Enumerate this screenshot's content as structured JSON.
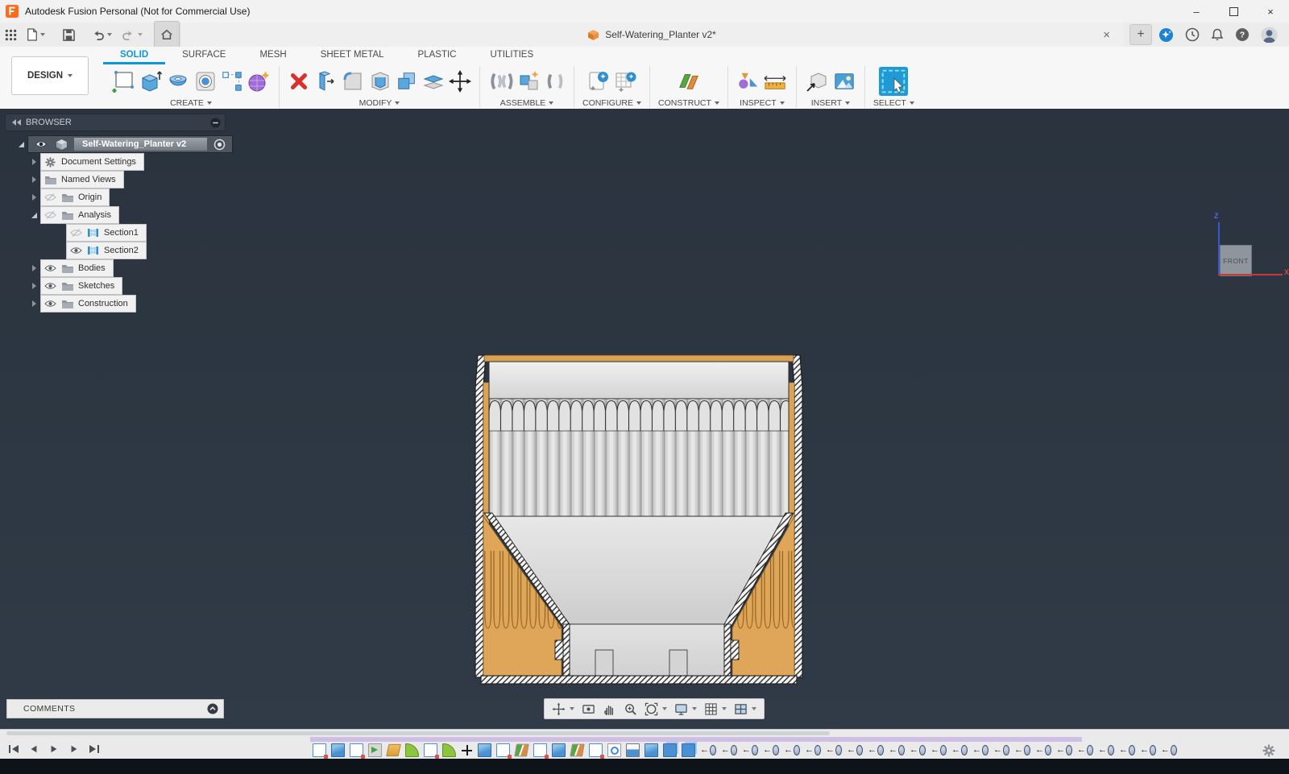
{
  "window": {
    "title": "Autodesk Fusion Personal (Not for Commercial Use)",
    "minimize": "–",
    "close": "×"
  },
  "appbar": {
    "left_icons": [
      "app-launcher-grid",
      "file-new",
      "save",
      "undo",
      "redo",
      "home"
    ],
    "tab": {
      "label": "Self-Watering_Planter v2*",
      "close": "×",
      "new_tab": "+"
    },
    "right_icons": [
      "extensions",
      "job-status",
      "notifications",
      "help",
      "profile"
    ]
  },
  "ribbon": {
    "workspace_label": "DESIGN",
    "tabs": [
      {
        "label": "SOLID",
        "active": true
      },
      {
        "label": "SURFACE",
        "active": false
      },
      {
        "label": "MESH",
        "active": false
      },
      {
        "label": "SHEET METAL",
        "active": false
      },
      {
        "label": "PLASTIC",
        "active": false
      },
      {
        "label": "UTILITIES",
        "active": false
      }
    ],
    "groups": [
      {
        "label": "CREATE"
      },
      {
        "label": "MODIFY"
      },
      {
        "label": "ASSEMBLE"
      },
      {
        "label": "CONFIGURE"
      },
      {
        "label": "CONSTRUCT"
      },
      {
        "label": "INSPECT"
      },
      {
        "label": "INSERT"
      },
      {
        "label": "SELECT"
      }
    ]
  },
  "browser": {
    "header": "BROWSER",
    "root": {
      "label": "Self-Watering_Planter v2",
      "visible": true
    },
    "items": [
      {
        "label": "Document Settings",
        "icon": "gear",
        "eye": null,
        "arrow": "collapsed",
        "level": 1
      },
      {
        "label": "Named Views",
        "icon": "folder",
        "eye": null,
        "arrow": "collapsed",
        "level": 1
      },
      {
        "label": "Origin",
        "icon": "folder",
        "eye": "off",
        "arrow": "collapsed",
        "level": 1
      },
      {
        "label": "Analysis",
        "icon": "folder",
        "eye": "off",
        "arrow": "expanded",
        "level": 1
      },
      {
        "label": "Section1",
        "icon": "section",
        "eye": "off",
        "arrow": null,
        "level": 2
      },
      {
        "label": "Section2",
        "icon": "section",
        "eye": "on",
        "arrow": null,
        "level": 2
      },
      {
        "label": "Bodies",
        "icon": "folder",
        "eye": "on",
        "arrow": "collapsed",
        "level": 1
      },
      {
        "label": "Sketches",
        "icon": "folder",
        "eye": "on",
        "arrow": "collapsed",
        "level": 1
      },
      {
        "label": "Construction",
        "icon": "folder",
        "eye": "on",
        "arrow": "collapsed",
        "level": 1
      }
    ]
  },
  "viewcube": {
    "face": "FRONT",
    "axis_vertical": "Z",
    "axis_horizontal": "X"
  },
  "comments": {
    "label": "COMMENTS"
  },
  "navbar": {
    "items": [
      "orbit",
      "look-at",
      "pan",
      "zoom",
      "fit",
      "display-settings",
      "grid-snaps",
      "viewports"
    ]
  },
  "timeline": {
    "playback": [
      "go-to-start",
      "step-back",
      "play",
      "step-forward",
      "go-to-end"
    ],
    "features": [
      "sketch",
      "extrude",
      "sketch",
      "revolve",
      "plane",
      "fillet",
      "sketch",
      "fillet",
      "move",
      "extrude",
      "sketch",
      "midplane",
      "sketch",
      "extrude",
      "midplane",
      "sketch",
      "hole",
      "web",
      "extrude",
      "combine",
      "combine",
      "joint",
      "joint",
      "joint",
      "joint",
      "joint",
      "joint",
      "joint",
      "joint",
      "joint",
      "joint",
      "joint",
      "joint",
      "joint",
      "joint",
      "joint",
      "joint",
      "joint",
      "joint",
      "joint",
      "joint",
      "joint",
      "joint",
      "joint"
    ],
    "settings": "gear"
  },
  "colors": {
    "canvas_bg": "#2d3743",
    "accent_blue": "#0a99d6",
    "section_cut_tan": "#dca355",
    "body_gray": "#dcdcdc",
    "timeline_group_bar": "#cfbfe4",
    "viewcube_z_axis": "#3d56c9",
    "viewcube_x_axis": "#c23b3b"
  }
}
